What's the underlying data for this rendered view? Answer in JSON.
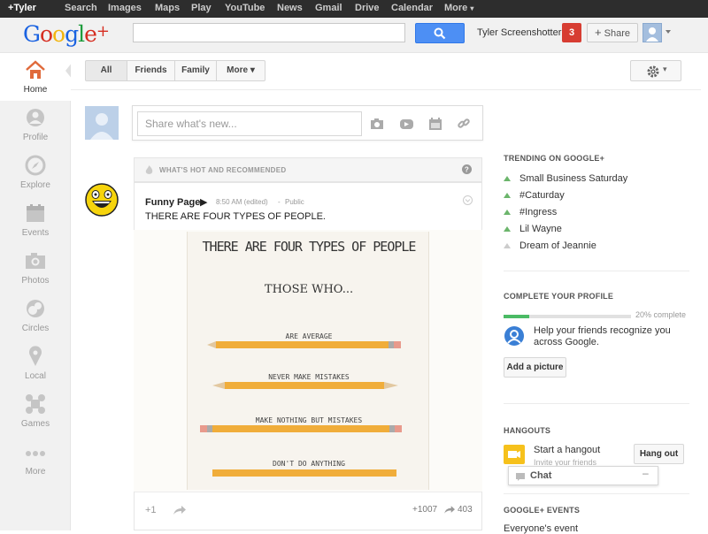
{
  "topbar": {
    "items": [
      "+Tyler",
      "Search",
      "Images",
      "Maps",
      "Play",
      "YouTube",
      "News",
      "Gmail",
      "Drive",
      "Calendar",
      "More"
    ]
  },
  "header": {
    "logo_text": "Google",
    "logo_plus": "+",
    "search_value": "",
    "username": "Tyler Screenshotter",
    "notifications": "3",
    "share_label": "Share"
  },
  "sidebar": {
    "items": [
      {
        "label": "Home",
        "icon": "home-icon"
      },
      {
        "label": "Profile",
        "icon": "profile-icon"
      },
      {
        "label": "Explore",
        "icon": "compass-icon"
      },
      {
        "label": "Events",
        "icon": "calendar-icon"
      },
      {
        "label": "Photos",
        "icon": "camera-icon"
      },
      {
        "label": "Circles",
        "icon": "circles-icon"
      },
      {
        "label": "Local",
        "icon": "map-pin-icon"
      },
      {
        "label": "Games",
        "icon": "games-icon"
      },
      {
        "label": "More",
        "icon": "more-dots-icon"
      }
    ]
  },
  "filters": {
    "all": "All",
    "friends": "Friends",
    "family": "Family",
    "more": "More"
  },
  "sharebox": {
    "placeholder": "Share what's new..."
  },
  "stream": {
    "hot_header": "WHAT'S HOT AND RECOMMENDED",
    "post": {
      "author": "Funny Page",
      "time": "8:50 AM (edited)",
      "visibility": "Public",
      "text": "THERE ARE FOUR TYPES OF PEOPLE.",
      "plus_one": "+1",
      "plus_count": "+1007",
      "share_count": "403",
      "image": {
        "title": "THERE ARE FOUR TYPES OF PEOPLE",
        "subtitle": "THOSE WHO...",
        "captions": [
          "ARE AVERAGE",
          "NEVER MAKE MISTAKES",
          "MAKE NOTHING BUT MISTAKES",
          "DON'T DO ANYTHING"
        ]
      }
    }
  },
  "trending": {
    "title": "TRENDING ON GOOGLE+",
    "items": [
      {
        "label": "Small Business Saturday",
        "trend": "up"
      },
      {
        "label": "#Caturday",
        "trend": "up"
      },
      {
        "label": "#Ingress",
        "trend": "up"
      },
      {
        "label": "Lil Wayne",
        "trend": "up"
      },
      {
        "label": "Dream of Jeannie",
        "trend": "neutral"
      }
    ]
  },
  "profile": {
    "title": "COMPLETE YOUR PROFILE",
    "percent_label": "20% complete",
    "progress": 0.2,
    "tip_line1": "Help your friends recognize you",
    "tip_line2": "across Google.",
    "button": "Add a picture"
  },
  "hangouts": {
    "title": "HANGOUTS",
    "start": "Start a hangout",
    "sub": "Invite your friends",
    "button": "Hang out"
  },
  "chat": {
    "label": "Chat"
  },
  "events": {
    "title": "GOOGLE+ EVENTS",
    "sub": "Everyone's event"
  },
  "colors": {
    "accent": "#4d8ff4",
    "notif": "#d73d32",
    "progress": "#4bbb65"
  }
}
